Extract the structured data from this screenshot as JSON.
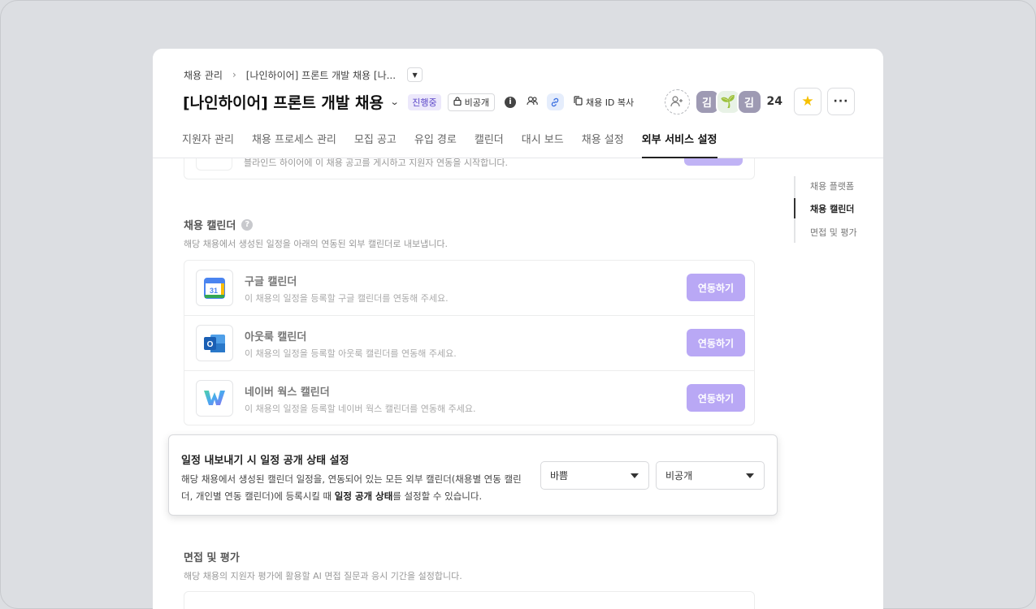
{
  "breadcrumb": {
    "root": "채용 관리",
    "current": "[나인하이어] 프론트 개발 채용 [나..."
  },
  "header": {
    "title": "[나인하이어] 프론트 개발 채용",
    "status_badge": "진행중",
    "visibility_badge": "비공개",
    "copy_id_label": "채용 ID 복사",
    "member_count": "24",
    "avatars": [
      "김",
      "🌱",
      "김"
    ]
  },
  "tabs": [
    "지원자 관리",
    "채용 프로세스 관리",
    "모집 공고",
    "유입 경로",
    "캘린더",
    "대시 보드",
    "채용 설정",
    "외부 서비스 설정"
  ],
  "active_tab": "외부 서비스 설정",
  "previous_section": {
    "desc": "블라인드 하이어에 이 채용 공고를 게시하고 지원자 연동을 시작합니다."
  },
  "calendar_section": {
    "title": "채용 캘린더",
    "desc": "해당 채용에서 생성된 일정을 아래의 연동된 외부 캘린더로 내보냅니다.",
    "items": [
      {
        "name": "구글 캘린더",
        "desc": "이 채용의 일정을 등록할 구글 캘린더를 연동해 주세요.",
        "button": "연동하기",
        "icon": "google-calendar-icon"
      },
      {
        "name": "아웃룩 캘린더",
        "desc": "이 채용의 일정을 등록할 아웃룩 캘린더를 연동해 주세요.",
        "button": "연동하기",
        "icon": "outlook-icon"
      },
      {
        "name": "네이버 웍스 캘린더",
        "desc": "이 채용의 일정을 등록할 네이버 웍스 캘린더를 연동해 주세요.",
        "button": "연동하기",
        "icon": "naver-works-icon"
      }
    ]
  },
  "popup": {
    "title": "일정 내보내기 시 일정 공개 상태 설정",
    "desc_prefix": "해당 채용에서 생성된 캘린더 일정을, 연동되어 있는 모든 외부 캘린더(채용별 연동 캘린더, 개인별 연동 캘린더)에 등록시킬 때 ",
    "desc_bold": "일정 공개 상태",
    "desc_suffix": "를 설정할 수 있습니다.",
    "select_busy": "바쁨",
    "select_visibility": "비공개"
  },
  "interview_section": {
    "title": "면접 및 평가",
    "desc": "해당 채용의 지원자 평가에 활용할 AI 면접 질문과 응시 기간을 설정합니다."
  },
  "toc": [
    "채용 플랫폼",
    "채용 캘린더",
    "면접 및 평가"
  ],
  "toc_active": "채용 캘린더",
  "colors": {
    "accent": "#b9a8f5",
    "status_bg": "#ece8fb",
    "status_text": "#5a45c8",
    "star": "#f6c000"
  }
}
